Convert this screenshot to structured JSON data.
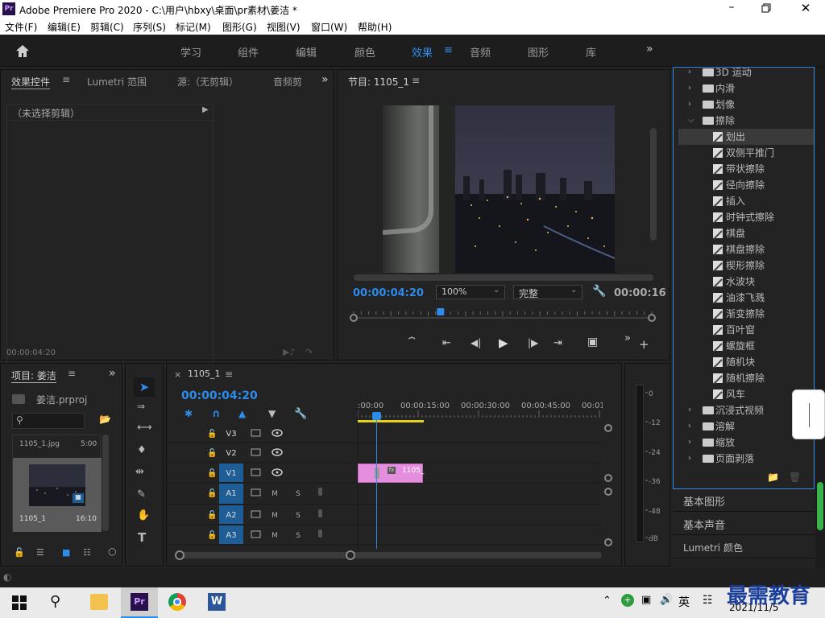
{
  "titlebar": {
    "title": "Adobe Premiere Pro 2020 - C:\\用户\\hbxy\\桌面\\pr素材\\姜洁 *",
    "app_icon": "Pr"
  },
  "menu": [
    "文件(F)",
    "编辑(E)",
    "剪辑(C)",
    "序列(S)",
    "标记(M)",
    "图形(G)",
    "视图(V)",
    "窗口(W)",
    "帮助(H)"
  ],
  "workspaces": [
    {
      "label": "学习"
    },
    {
      "label": "组件"
    },
    {
      "label": "编辑"
    },
    {
      "label": "颜色"
    },
    {
      "label": "效果",
      "active": true
    },
    {
      "label": "音频"
    },
    {
      "label": "图形"
    },
    {
      "label": "库"
    }
  ],
  "source_panel": {
    "tabs": [
      "效果控件",
      "Lumetri 范围",
      "源:（无剪辑）",
      "音频剪"
    ],
    "no_clip": "（未选择剪辑）",
    "timecode": "00:00:04:20"
  },
  "program": {
    "title": "节目: 1105_1",
    "timecode": "00:00:04:20",
    "zoom": "100%",
    "quality": "完整",
    "duration": "00:00:16",
    "playhead_fraction": 0.29
  },
  "project": {
    "tab": "项目: 姜洁",
    "file": "姜洁.prproj",
    "clip_name": "1105_1.jpg",
    "clip_duration": "5:00",
    "seq_name": "1105_1",
    "seq_duration": "16:10"
  },
  "timeline": {
    "tab": "1105_1",
    "timecode": "00:00:04:20",
    "ruler": [
      ":00:00",
      "00:00:15:00",
      "00:00:30:00",
      "00:00:45:00",
      "00:01:0"
    ],
    "tracks": [
      {
        "id": "V3"
      },
      {
        "id": "V2"
      },
      {
        "id": "V1",
        "active": true
      },
      {
        "id": "A1",
        "active": true,
        "m": "M",
        "s": "S"
      },
      {
        "id": "A2",
        "active": true,
        "m": "M",
        "s": "S"
      },
      {
        "id": "A3",
        "active": true,
        "m": "M",
        "s": "S"
      }
    ],
    "clip_label": "1105_",
    "fx_badge": "fx"
  },
  "meter": {
    "labels": [
      "0",
      "-12",
      "-24",
      "-36",
      "-48",
      "dB"
    ]
  },
  "effects": {
    "items": [
      {
        "label": "3D 运动",
        "type": "folder"
      },
      {
        "label": "内滑",
        "type": "folder"
      },
      {
        "label": "划像",
        "type": "folder"
      },
      {
        "label": "擦除",
        "type": "folder-open"
      },
      {
        "label": "划出",
        "type": "effect",
        "selected": true
      },
      {
        "label": "双侧平推门",
        "type": "effect"
      },
      {
        "label": "带状擦除",
        "type": "effect"
      },
      {
        "label": "径向擦除",
        "type": "effect"
      },
      {
        "label": "插入",
        "type": "effect"
      },
      {
        "label": "时钟式擦除",
        "type": "effect"
      },
      {
        "label": "棋盘",
        "type": "effect"
      },
      {
        "label": "棋盘擦除",
        "type": "effect"
      },
      {
        "label": "楔形擦除",
        "type": "effect"
      },
      {
        "label": "水波块",
        "type": "effect"
      },
      {
        "label": "油漆飞溅",
        "type": "effect"
      },
      {
        "label": "渐变擦除",
        "type": "effect"
      },
      {
        "label": "百叶窗",
        "type": "effect"
      },
      {
        "label": "螺旋框",
        "type": "effect"
      },
      {
        "label": "随机块",
        "type": "effect"
      },
      {
        "label": "随机擦除",
        "type": "effect"
      },
      {
        "label": "风车",
        "type": "effect"
      },
      {
        "label": "沉浸式视频",
        "type": "folder"
      },
      {
        "label": "溶解",
        "type": "folder"
      },
      {
        "label": "缩放",
        "type": "folder"
      },
      {
        "label": "页面剥落",
        "type": "folder"
      }
    ],
    "sections": [
      "基本图形",
      "基本声音",
      "Lumetri 颜色"
    ]
  },
  "taskbar": {
    "ime": "英",
    "date": "2021/11/5",
    "watermark": "最需教育"
  },
  "colors": {
    "accent": "#2d8ceb",
    "clip": "#e58ee0",
    "selected_bg": "#3a3a3a",
    "panel": "#232323"
  }
}
